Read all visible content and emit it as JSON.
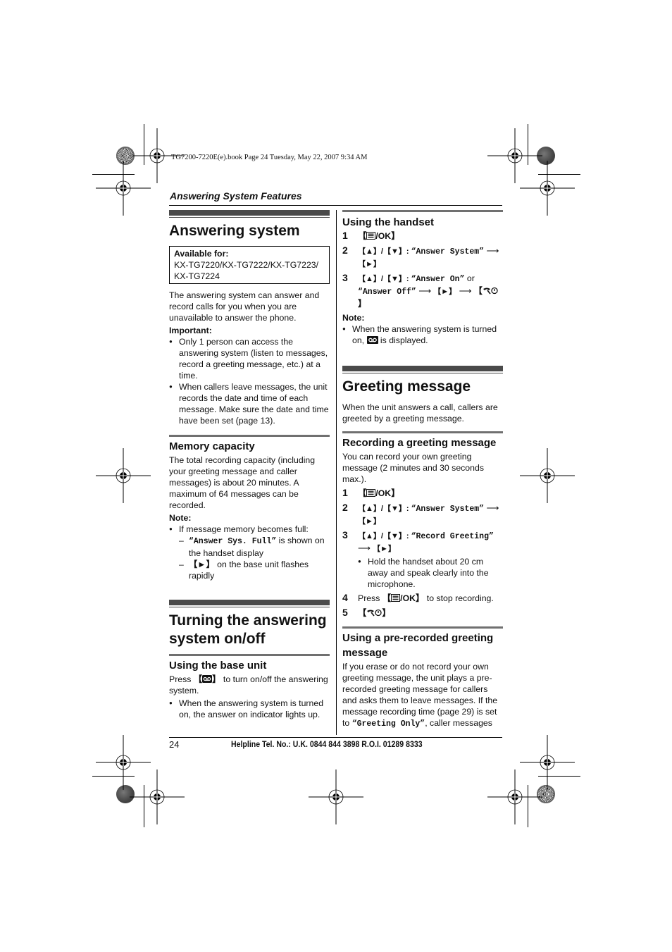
{
  "slug": "TG7200-7220E(e).book  Page 24  Tuesday, May 22, 2007  9:34 AM",
  "running_head": "Answering System Features",
  "left": {
    "answering_system": {
      "title": "Answering system",
      "available_label": "Available for:",
      "available_models": "KX-TG7220/KX-TG7222/KX-TG7223/ KX-TG7224",
      "intro": "The answering system can answer and record calls for you when you are unavailable to answer the phone.",
      "important_label": "Important:",
      "important_items": [
        "Only 1 person can access the answering system (listen to messages, record a greeting message, etc.) at a time.",
        "When callers leave messages, the unit records the date and time of each message. Make sure the date and time have been set (page 13)."
      ]
    },
    "memory_capacity": {
      "title": "Memory capacity",
      "body": "The total recording capacity (including your greeting message and caller messages) is about 20 minutes. A maximum of 64 messages can be recorded.",
      "note_label": "Note:",
      "note_item": "If message memory becomes full:",
      "sub_items": {
        "full_display": "“Answer Sys. Full”",
        "full_suffix": " is shown on the handset display",
        "flash_key": "【►】",
        "flash_suffix": " on the base unit flashes rapidly"
      }
    },
    "turning": {
      "title": "Turning the answering system on/off",
      "base_unit_title": "Using the base unit",
      "press": "Press ",
      "press_suffix": " to turn on/off the answering system.",
      "bullet": "When the answering system is turned on, the answer on indicator lights up."
    }
  },
  "right": {
    "handset": {
      "title": "Using the handset",
      "steps": [
        {
          "num": "1",
          "key": "/OK"
        },
        {
          "num": "2",
          "nav": "【▲】/【▼】: ",
          "menu": "“Answer System”",
          "arrow": " ⟶ ",
          "key2": "【►】"
        },
        {
          "num": "3",
          "nav": "【▲】/【▼】: ",
          "menu": "“Answer On”",
          "or": " or ",
          "menu2": "“Answer Off”",
          "arrow": " ⟶ ",
          "key2": "【►】"
        }
      ],
      "note_label": "Note:",
      "note_pre": "When the answering system is turned on, ",
      "note_post": " is displayed."
    },
    "greeting": {
      "title": "Greeting message",
      "intro": "When the unit answers a call, callers are greeted by a greeting message.",
      "recording_title": "Recording a greeting message",
      "recording_body": "You can record your own greeting message (2 minutes and 30 seconds max.).",
      "steps": [
        {
          "num": "1",
          "key": "/OK"
        },
        {
          "num": "2",
          "nav": "【▲】/【▼】: ",
          "menu": "“Answer System”",
          "arrow": " ⟶ ",
          "key2": "【►】"
        },
        {
          "num": "3",
          "nav": "【▲】/【▼】: ",
          "menu": "“Record Greeting”",
          "arrow": " ⟶ ",
          "key2": "【►】",
          "bullet": "Hold the handset about 20 cm away and speak clearly into the microphone."
        },
        {
          "num": "4",
          "pre": "Press ",
          "key": "/OK",
          "post": " to stop recording."
        },
        {
          "num": "5"
        }
      ],
      "prerecorded_title": "Using a pre-recorded greeting message",
      "prerecorded_body": "If you erase or do not record your own greeting message, the unit plays a pre-recorded greeting message for callers and asks them to leave messages. If the message recording time (page 29) is set to ",
      "prerecorded_mono": "“Greeting Only”",
      "prerecorded_tail": ", caller messages"
    }
  },
  "footer": {
    "page_number": "24",
    "helpline": "Helpline Tel. No.: U.K. 0844 844 3898 R.O.I. 01289 8333"
  }
}
